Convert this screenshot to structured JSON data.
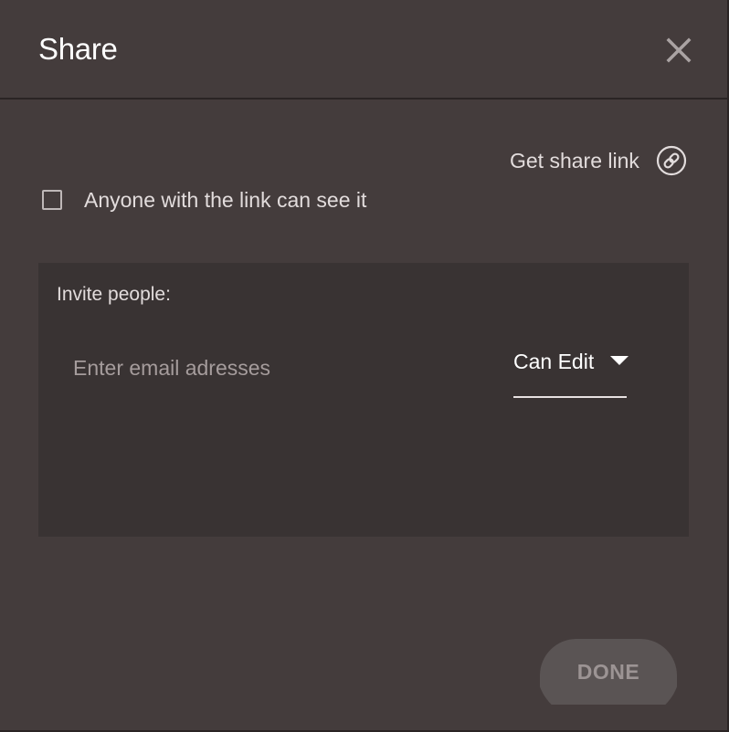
{
  "dialog": {
    "title": "Share",
    "close_icon": "close-icon"
  },
  "share_link": {
    "label": "Get share link",
    "icon": "link-icon"
  },
  "public_access": {
    "label": "Anyone with the link can see it",
    "checked": false
  },
  "invite": {
    "label": "Invite people:",
    "email_placeholder": "Enter email adresses",
    "email_value": "",
    "permission_selected": "Can Edit"
  },
  "actions": {
    "done_label": "DONE"
  },
  "colors": {
    "background": "#443c3c",
    "panel": "#393333",
    "text": "#e2dcdc",
    "button": "#5a5454",
    "button_text": "#9c9494"
  }
}
